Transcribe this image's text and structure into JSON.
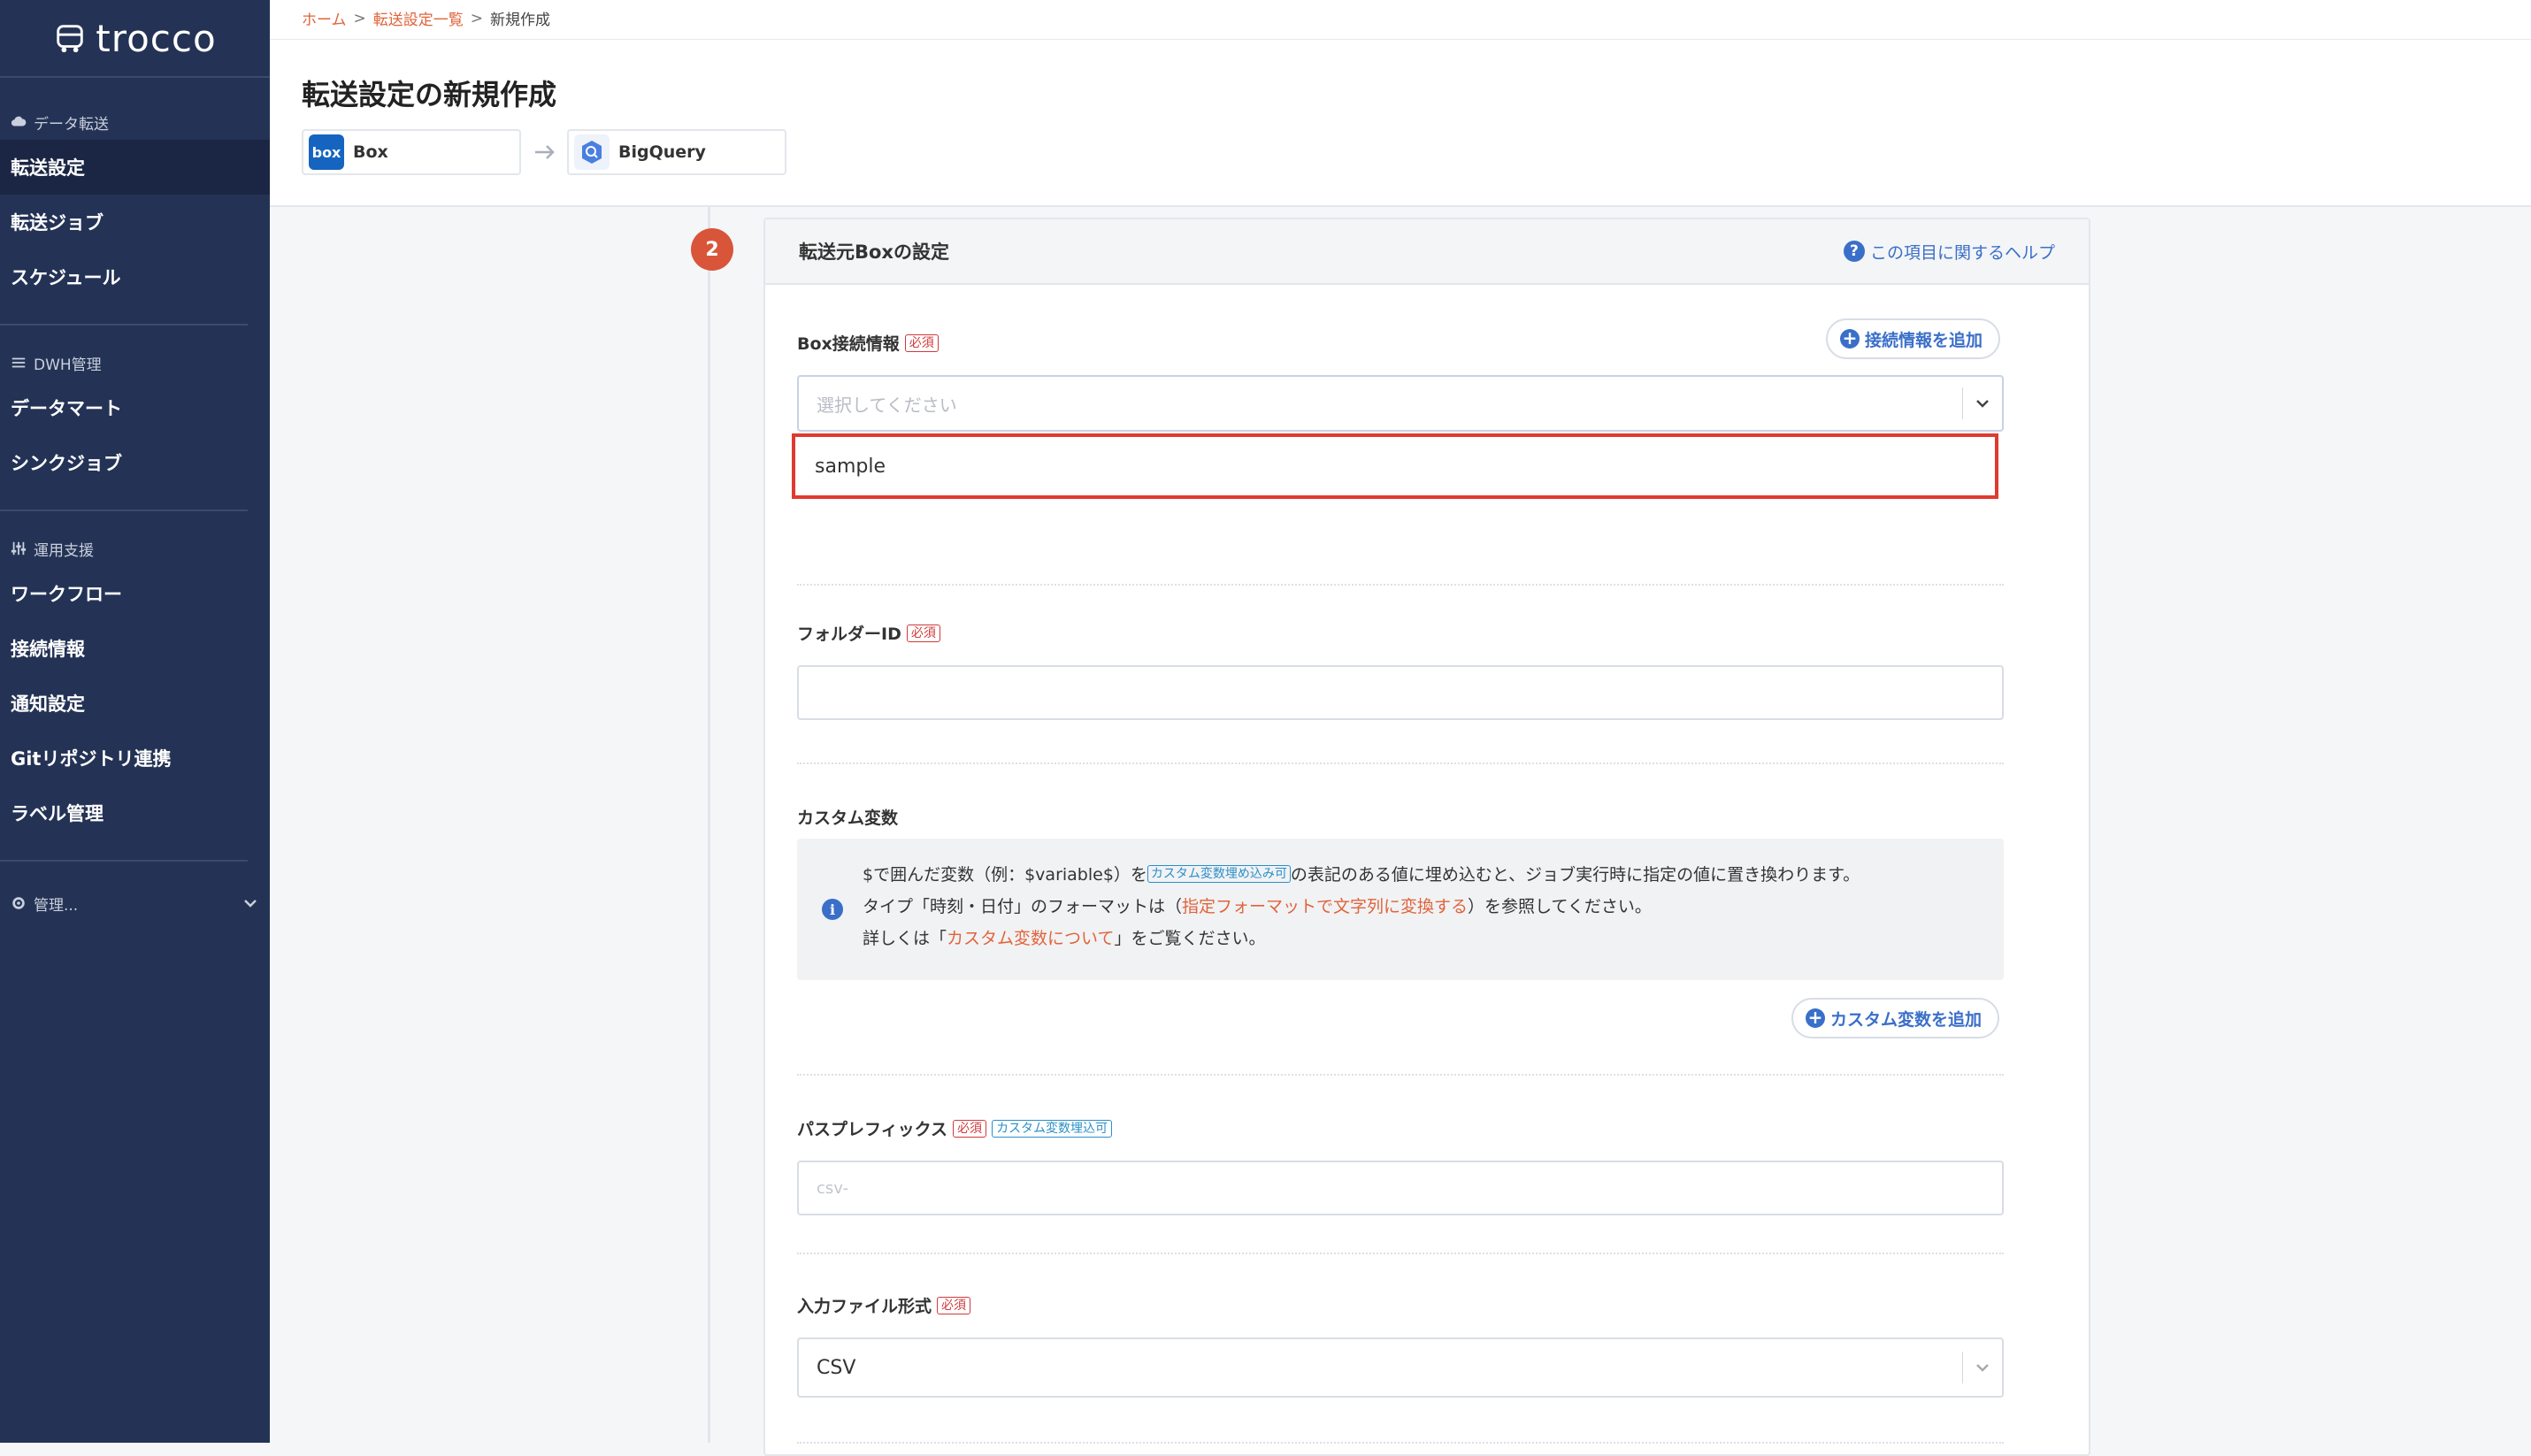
{
  "app": {
    "name": "trocco"
  },
  "sidebar": {
    "sections": [
      {
        "heading": "データ転送",
        "items": [
          "転送設定",
          "転送ジョブ",
          "スケジュール"
        ]
      },
      {
        "heading": "DWH管理",
        "items": [
          "データマート",
          "シンクジョブ"
        ]
      },
      {
        "heading": "運用支援",
        "items": [
          "ワークフロー",
          "接続情報",
          "通知設定",
          "Gitリポジトリ連携",
          "ラベル管理"
        ]
      }
    ],
    "admin": "管理..."
  },
  "breadcrumb": {
    "home": "ホーム",
    "list": "転送設定一覧",
    "current": "新規作成"
  },
  "page": {
    "title": "転送設定の新規作成",
    "source": {
      "label": "Box",
      "icon_text": "box"
    },
    "destination": {
      "label": "BigQuery"
    }
  },
  "step": {
    "number": "2"
  },
  "card": {
    "title": "転送元Boxの設定",
    "help": "この項目に関するヘルプ"
  },
  "form": {
    "box_connection": {
      "label": "Box接続情報",
      "required": "必須",
      "add_button": "接続情報を追加",
      "placeholder": "選択してください",
      "option": "sample"
    },
    "folder_id": {
      "label": "フォルダーID",
      "required": "必須",
      "value": ""
    },
    "custom_vars": {
      "label": "カスタム変数",
      "line1_a": "$で囲んだ変数（例：$variable$）を",
      "line1_tag": "カスタム変数埋め込み可",
      "line1_b": "の表記のある値に埋め込むと、ジョブ実行時に指定の値に置き換わります。",
      "line2_a": "タイプ「時刻・日付」のフォーマットは（",
      "line2_link": "指定フォーマットで文字列に変換する",
      "line2_b": "）を参照してください。",
      "line3_a": "詳しくは「",
      "line3_link": "カスタム変数について",
      "line3_b": "」をご覧ください。",
      "add_button": "カスタム変数を追加"
    },
    "path_prefix": {
      "label": "パスプレフィックス",
      "required": "必須",
      "var_badge": "カスタム変数埋込可",
      "placeholder": "csv-"
    },
    "input_format": {
      "label": "入力ファイル形式",
      "required": "必須",
      "value": "CSV"
    }
  }
}
